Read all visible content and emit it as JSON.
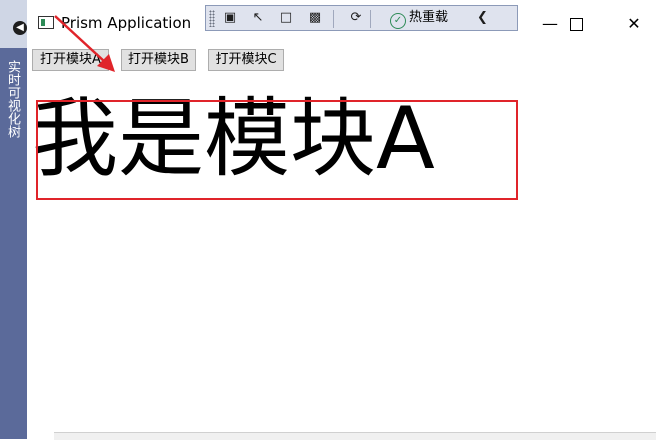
{
  "side_panel": {
    "label": "实时可视化树",
    "arrow_icon": "back-arrow-icon"
  },
  "window": {
    "title": "Prism Application"
  },
  "toolbar": {
    "hot_reload_label": "热重载"
  },
  "buttons": {
    "open_a": "打开模块A",
    "open_b": "打开模块B",
    "open_c": "打开模块C"
  },
  "content": {
    "module_text": "我是模块A"
  },
  "colors": {
    "highlight": "#e0242a",
    "side_panel": "#5b6a9a",
    "toolbar_bg": "#dfe3ee"
  }
}
